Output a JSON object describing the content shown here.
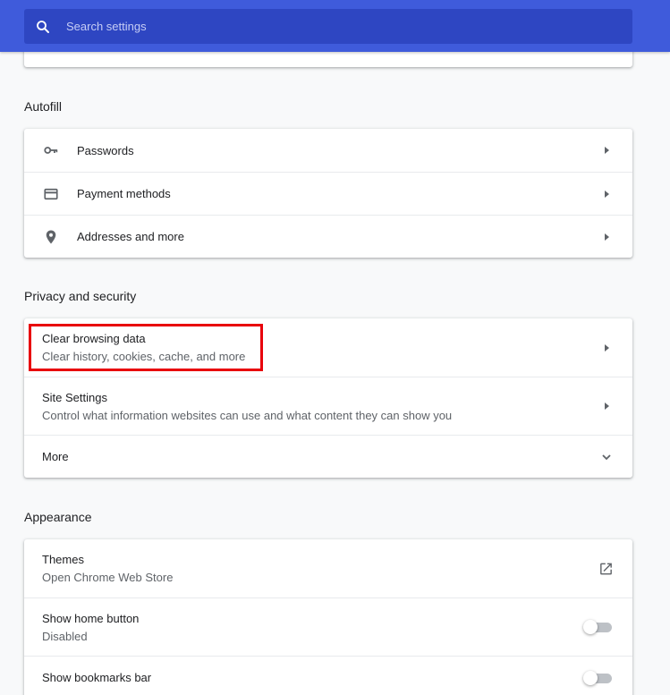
{
  "search": {
    "placeholder": "Search settings"
  },
  "autofill": {
    "title": "Autofill",
    "items": [
      {
        "label": "Passwords",
        "icon": "key-icon"
      },
      {
        "label": "Payment methods",
        "icon": "credit-card-icon"
      },
      {
        "label": "Addresses and more",
        "icon": "location-pin-icon"
      }
    ]
  },
  "privacy": {
    "title": "Privacy and security",
    "items": [
      {
        "label": "Clear browsing data",
        "sublabel": "Clear history, cookies, cache, and more"
      },
      {
        "label": "Site Settings",
        "sublabel": "Control what information websites can use and what content they can show you"
      },
      {
        "label": "More"
      }
    ]
  },
  "appearance": {
    "title": "Appearance",
    "items": [
      {
        "label": "Themes",
        "sublabel": "Open Chrome Web Store"
      },
      {
        "label": "Show home button",
        "sublabel": "Disabled"
      },
      {
        "label": "Show bookmarks bar"
      }
    ]
  },
  "colors": {
    "header": "#3f5bdb",
    "search_box": "#2e46c2",
    "highlight": "#e8000b"
  }
}
